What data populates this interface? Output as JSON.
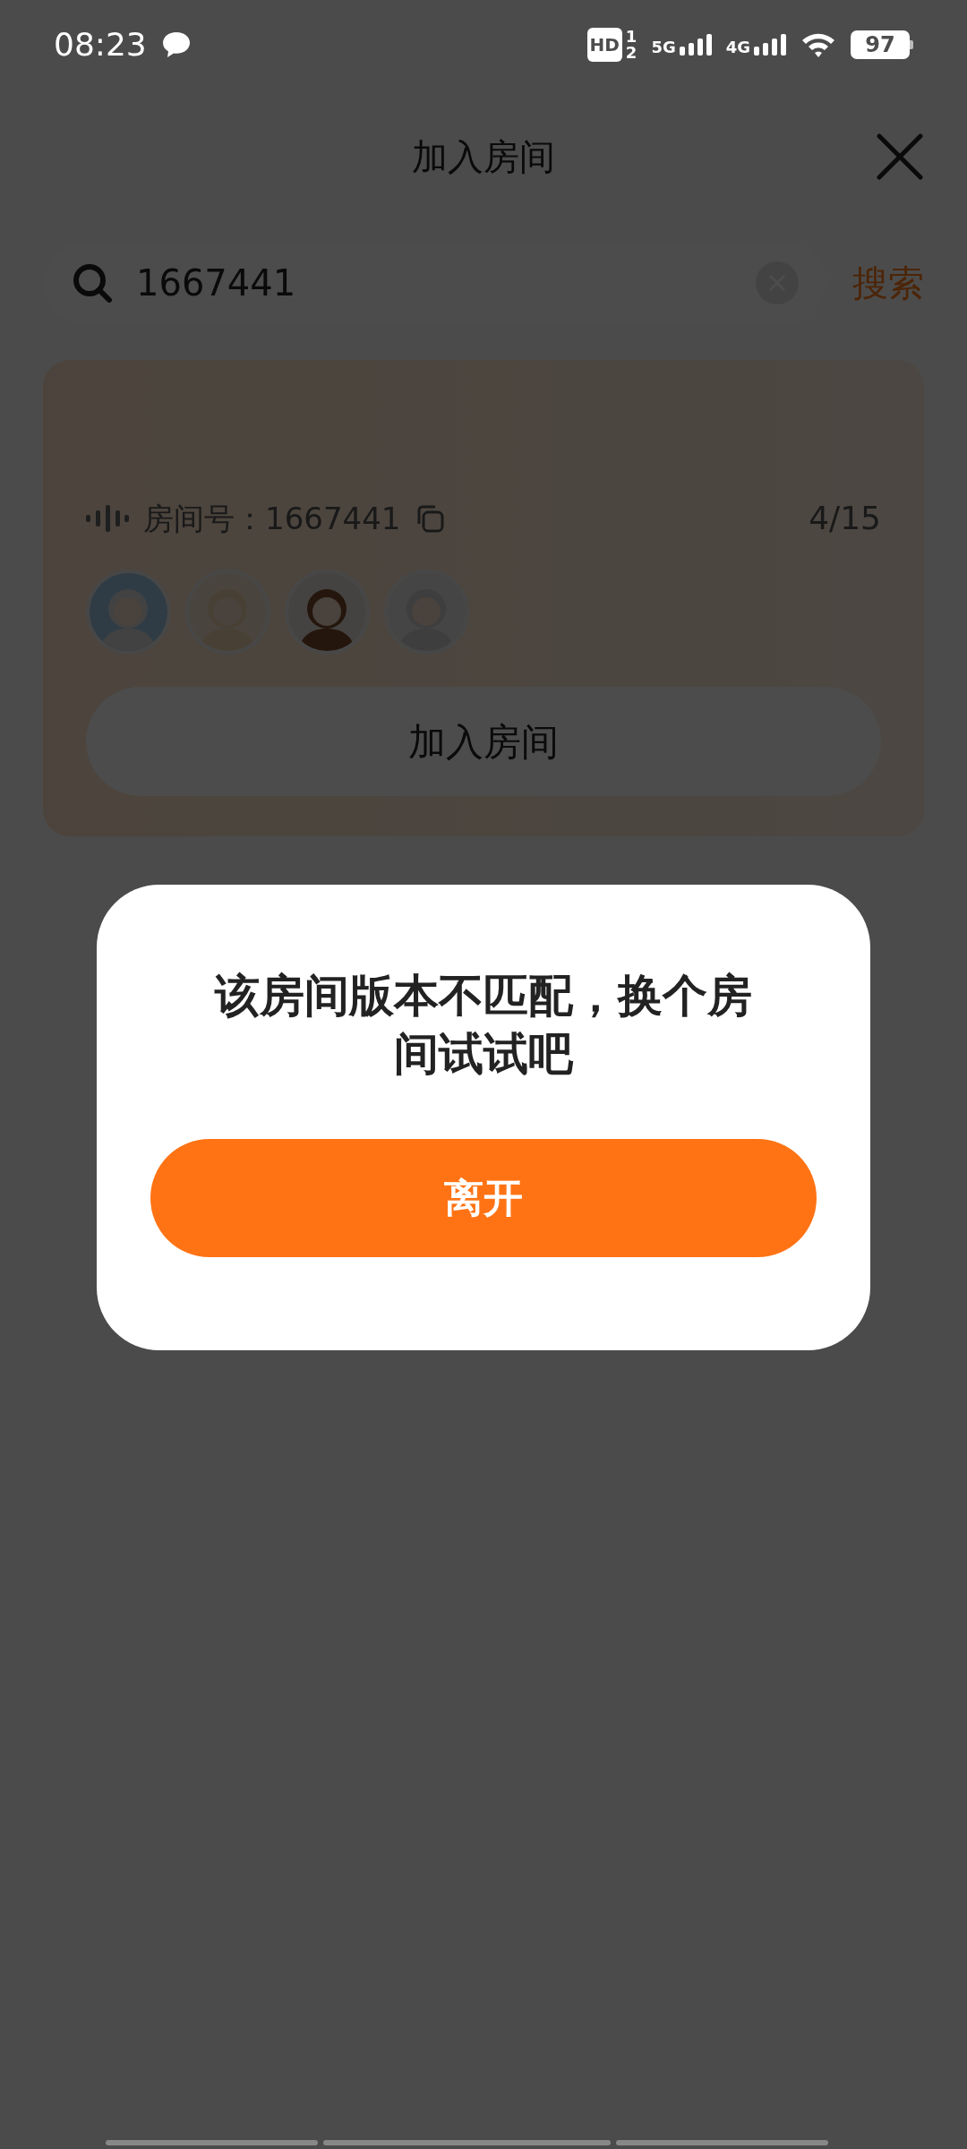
{
  "status_bar": {
    "time": "08:23",
    "hd": "HD",
    "sim_labels": [
      "1",
      "2"
    ],
    "networks": [
      "5G",
      "4G"
    ],
    "battery": "97"
  },
  "header": {
    "title": "加入房间"
  },
  "search": {
    "value": "1667441",
    "button": "搜索"
  },
  "room": {
    "number_label": "房间号：1667441",
    "occupancy": "4/15",
    "join_button": "加入房间"
  },
  "dialog": {
    "message": "该房间版本不匹配，换个房间试试吧",
    "button": "离开"
  }
}
